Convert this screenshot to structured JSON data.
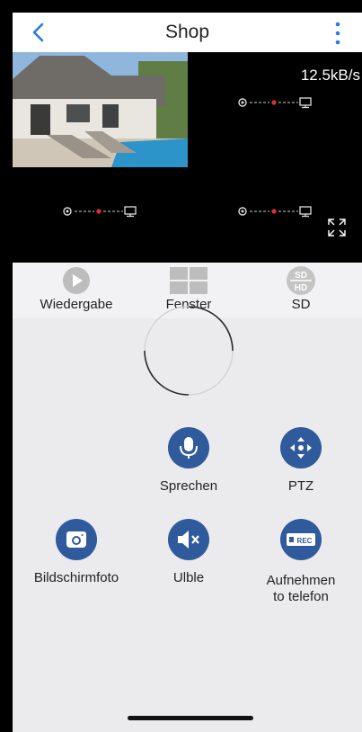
{
  "navbar": {
    "title": "Shop",
    "back_icon": "chevron-left-icon",
    "menu_icon": "more-vertical-icon"
  },
  "video": {
    "speed": "12.5kB/s"
  },
  "modes": [
    {
      "label": "Wiedergabe",
      "icon": "play-icon"
    },
    {
      "label": "Fenster",
      "icon": "grid-icon"
    },
    {
      "label": "SD",
      "icon": "sd-hd-icon"
    }
  ],
  "actions": {
    "speak": "Sprechen",
    "ptz": "PTZ",
    "screenshot": "Bildschirmfoto",
    "mute": "Ulble",
    "record_line1": "Aufnehmen",
    "record_line2": "to telefon",
    "rec_badge": "REC"
  },
  "colors": {
    "accent": "#2f5a9c",
    "link": "#2a7ae2",
    "status_dot": "#e03030"
  }
}
